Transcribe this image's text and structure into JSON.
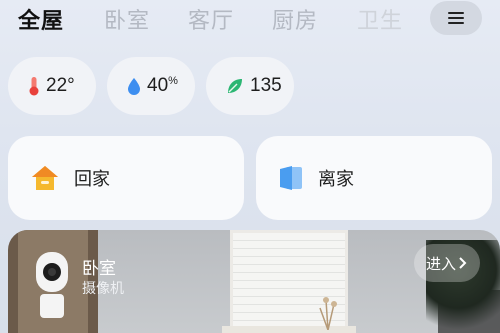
{
  "tabs": [
    {
      "label": "全屋"
    },
    {
      "label": "卧室"
    },
    {
      "label": "客厅"
    },
    {
      "label": "厨房"
    },
    {
      "label": "卫生"
    }
  ],
  "menu": {
    "icon": "menu-icon"
  },
  "sensors": [
    {
      "icon": "thermometer-icon",
      "value": "22",
      "unit": "°"
    },
    {
      "icon": "humidity-drop-icon",
      "value": "40",
      "unit": "%"
    },
    {
      "icon": "leaf-air-quality-icon",
      "value": "135",
      "unit": ""
    }
  ],
  "scenes": [
    {
      "icon": "home-icon",
      "label": "回家"
    },
    {
      "icon": "leave-door-icon",
      "label": "离家"
    }
  ],
  "camera": {
    "room": "卧室",
    "device": "摄像机",
    "enter_label": "进入",
    "enter_icon": "chevron-right-icon"
  },
  "colors": {
    "thermo": "#e8413c",
    "drop": "#3d8ef0",
    "leaf": "#2bb673",
    "home": "#f5b82e",
    "door": "#4a9df0"
  }
}
